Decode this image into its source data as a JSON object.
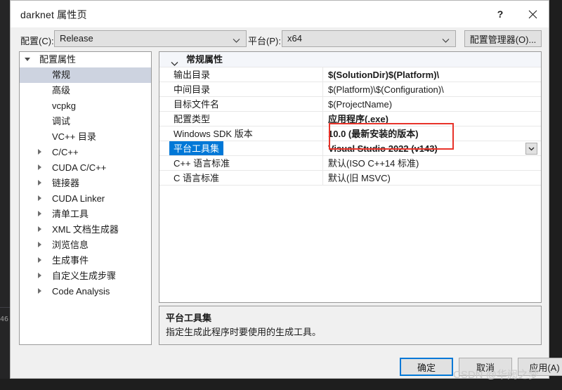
{
  "window": {
    "title": "darknet 属性页",
    "help_label": "?",
    "close_label": "✕"
  },
  "config_bar": {
    "configuration_label": "配置(C):",
    "configuration_value": "Release",
    "platform_label": "平台(P):",
    "platform_value": "x64",
    "config_manager_button": "配置管理器(O)..."
  },
  "tree": {
    "items": [
      {
        "label": "配置属性",
        "level": 0,
        "expander": "open",
        "selected": false
      },
      {
        "label": "常规",
        "level": 1,
        "expander": "none",
        "selected": true
      },
      {
        "label": "高级",
        "level": 1,
        "expander": "none",
        "selected": false
      },
      {
        "label": "vcpkg",
        "level": 1,
        "expander": "none",
        "selected": false
      },
      {
        "label": "调试",
        "level": 1,
        "expander": "none",
        "selected": false
      },
      {
        "label": "VC++ 目录",
        "level": 1,
        "expander": "none",
        "selected": false
      },
      {
        "label": "C/C++",
        "level": 1,
        "expander": "closed",
        "selected": false
      },
      {
        "label": "CUDA C/C++",
        "level": 1,
        "expander": "closed",
        "selected": false
      },
      {
        "label": "链接器",
        "level": 1,
        "expander": "closed",
        "selected": false
      },
      {
        "label": "CUDA Linker",
        "level": 1,
        "expander": "closed",
        "selected": false
      },
      {
        "label": "清单工具",
        "level": 1,
        "expander": "closed",
        "selected": false
      },
      {
        "label": "XML 文档生成器",
        "level": 1,
        "expander": "closed",
        "selected": false
      },
      {
        "label": "浏览信息",
        "level": 1,
        "expander": "closed",
        "selected": false
      },
      {
        "label": "生成事件",
        "level": 1,
        "expander": "closed",
        "selected": false
      },
      {
        "label": "自定义生成步骤",
        "level": 1,
        "expander": "closed",
        "selected": false
      },
      {
        "label": "Code Analysis",
        "level": 1,
        "expander": "closed",
        "selected": false
      }
    ]
  },
  "grid": {
    "category": "常规属性",
    "rows": [
      {
        "name": "输出目录",
        "value": "$(SolutionDir)$(Platform)\\",
        "bold": true,
        "selected": false,
        "dropdown": false
      },
      {
        "name": "中间目录",
        "value": "$(Platform)\\$(Configuration)\\",
        "bold": false,
        "selected": false,
        "dropdown": false
      },
      {
        "name": "目标文件名",
        "value": "$(ProjectName)",
        "bold": false,
        "selected": false,
        "dropdown": false
      },
      {
        "name": "配置类型",
        "value": "应用程序(.exe)",
        "bold": true,
        "selected": false,
        "dropdown": false
      },
      {
        "name": "Windows SDK 版本",
        "value": "10.0 (最新安装的版本)",
        "bold": true,
        "selected": false,
        "dropdown": false
      },
      {
        "name": "平台工具集",
        "value": "Visual Studio 2022 (v143)",
        "bold": true,
        "selected": true,
        "dropdown": true
      },
      {
        "name": "C++ 语言标准",
        "value": "默认(ISO C++14 标准)",
        "bold": false,
        "selected": false,
        "dropdown": false
      },
      {
        "name": "C 语言标准",
        "value": "默认(旧 MSVC)",
        "bold": false,
        "selected": false,
        "dropdown": false
      }
    ]
  },
  "description": {
    "title": "平台工具集",
    "body": "指定生成此程序时要使用的生成工具。"
  },
  "footer": {
    "ok": "确定",
    "cancel": "取消",
    "apply": "应用(A)"
  },
  "annotation": {
    "color": "#e8332a"
  },
  "watermark": {
    "text": "CSDN @华阙之梦"
  },
  "background": {
    "line_number": "46"
  }
}
